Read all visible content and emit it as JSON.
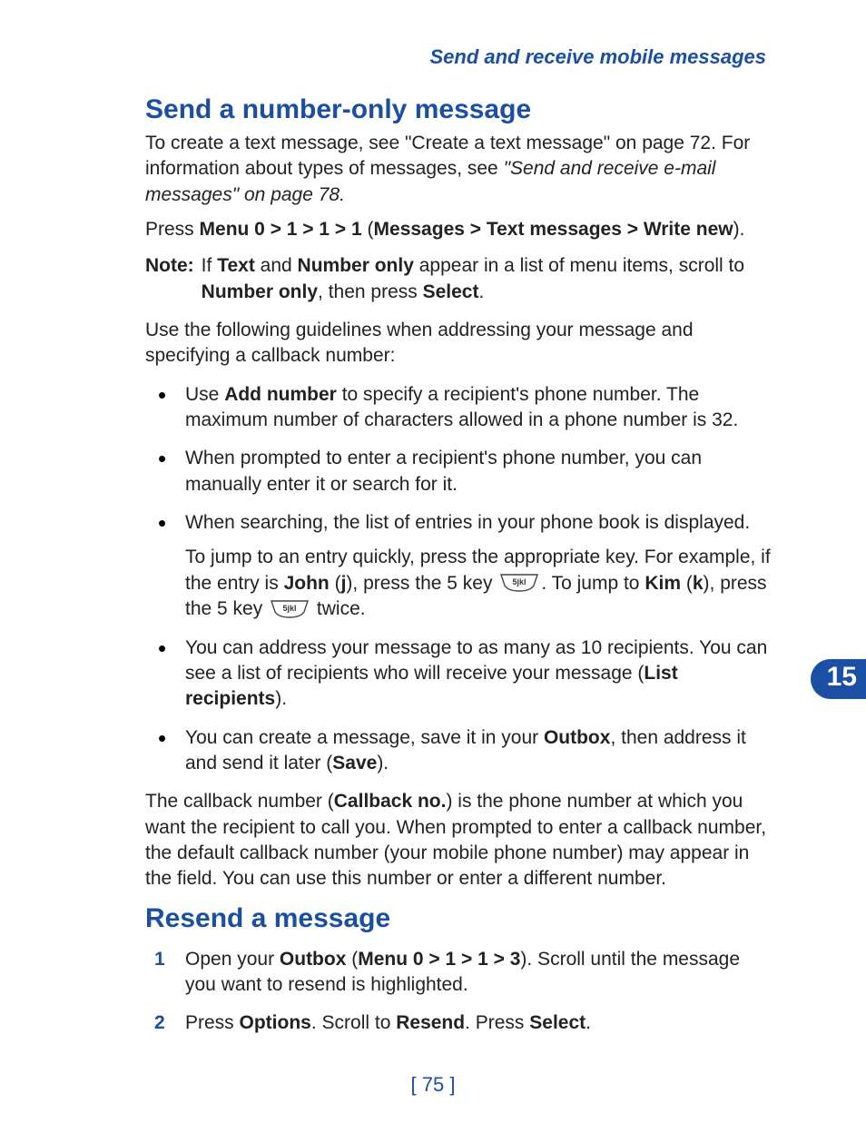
{
  "header": "Send and receive mobile messages",
  "chapter_tab": "15",
  "page_number": "[ 75 ]",
  "section1": {
    "title": "Send a number-only message",
    "intro_a": "To create a text message, see \"Create a text message\" on page 72. For information about types of messages, see ",
    "intro_b_italic": "\"Send and receive e-mail messages\" on page 78.",
    "press_a": "Press ",
    "press_b_bold": "Menu 0 > 1 > 1 > 1",
    "press_c": " (",
    "press_d_bold": "Messages > Text messages > Write new",
    "press_e": ").",
    "note_label": "Note:",
    "note_a": "If ",
    "note_b_bold": "Text",
    "note_c": " and ",
    "note_d_bold": "Number only",
    "note_e": " appear in a list of menu items, scroll to ",
    "note_f_bold": "Number only",
    "note_g": ", then press ",
    "note_h_bold": "Select",
    "note_i": ".",
    "guidelines": "Use the following guidelines when addressing your message and specifying a callback number:",
    "bullets": {
      "b1_a": "Use ",
      "b1_b_bold": "Add number",
      "b1_c": " to specify a recipient's phone number. The maximum number of characters allowed in a phone number is 32.",
      "b2": "When prompted to enter a recipient's phone number, you can manually enter it or search for it.",
      "b3": "When searching, the list of entries in your phone book is displayed.",
      "b3p_a": "To jump to an entry quickly, press the appropriate key. For example, if the entry is ",
      "b3p_b_bold": "John",
      "b3p_c": " (",
      "b3p_d_bold": "j",
      "b3p_e": "), press the 5 key ",
      "b3p_f": ". To jump to ",
      "b3p_g_bold": "Kim",
      "b3p_h": " (",
      "b3p_i_bold": "k",
      "b3p_j": "), press the 5 key ",
      "b3p_k": " twice.",
      "b4_a": "You can address your message to as many as 10 recipients. You can see a list of recipients who will receive your message (",
      "b4_b_bold": "List recipients",
      "b4_c": ").",
      "b5_a": "You can create a message, save it in your ",
      "b5_b_bold": "Outbox",
      "b5_c": ", then address it and send it later (",
      "b5_d_bold": "Save",
      "b5_e": ")."
    },
    "callback_a": "The callback number (",
    "callback_b_bold": "Callback no.",
    "callback_c": ") is the phone number at which you want the recipient to call you. When prompted to enter a callback number, the default callback number (your mobile phone number) may appear in the field. You can use this number or enter a different number."
  },
  "section2": {
    "title": "Resend a message",
    "s1_a": "Open your ",
    "s1_b_bold": "Outbox",
    "s1_c": " (",
    "s1_d_bold": "Menu 0 > 1 > 1 > 3",
    "s1_e": "). Scroll until the message you want to resend is highlighted.",
    "s2_a": "Press ",
    "s2_b_bold": "Options",
    "s2_c": ". Scroll to ",
    "s2_d_bold": "Resend",
    "s2_e": ". Press ",
    "s2_f_bold": "Select",
    "s2_g": "."
  },
  "key_label": "5jkl"
}
